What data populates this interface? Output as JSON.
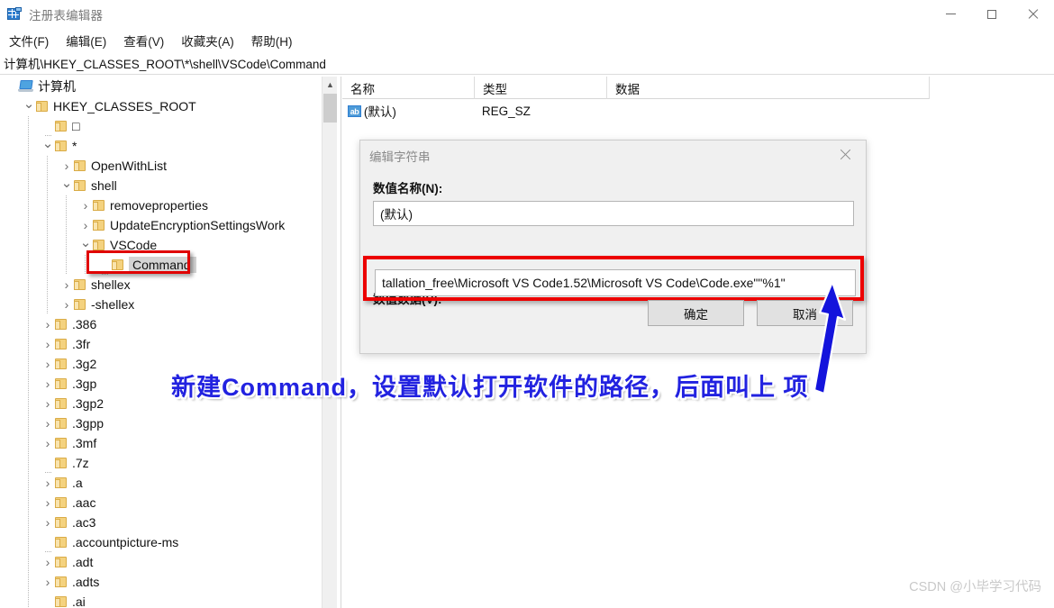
{
  "window": {
    "title": "注册表编辑器",
    "app_icon": "registry-editor-icon",
    "controls": {
      "minimize": "−",
      "maximize": "□",
      "close": "✕"
    }
  },
  "menubar": {
    "items": [
      {
        "label": "文件(F)",
        "name": "menu-file"
      },
      {
        "label": "编辑(E)",
        "name": "menu-edit"
      },
      {
        "label": "查看(V)",
        "name": "menu-view"
      },
      {
        "label": "收藏夹(A)",
        "name": "menu-favorites"
      },
      {
        "label": "帮助(H)",
        "name": "menu-help"
      }
    ]
  },
  "address": {
    "path": "计算机\\HKEY_CLASSES_ROOT\\*\\shell\\VSCode\\Command"
  },
  "tree": {
    "rows": [
      {
        "label": "计算机",
        "indent": 0,
        "chev": "none",
        "icon": "computer"
      },
      {
        "label": "HKEY_CLASSES_ROOT",
        "indent": 1,
        "chev": "expanded",
        "icon": "folder"
      },
      {
        "label": "□",
        "indent": 2,
        "chev": "stub",
        "icon": "folder"
      },
      {
        "label": "*",
        "indent": 2,
        "chev": "expanded",
        "icon": "folder"
      },
      {
        "label": "OpenWithList",
        "indent": 3,
        "chev": "collapsed",
        "icon": "folder"
      },
      {
        "label": "shell",
        "indent": 3,
        "chev": "expanded",
        "icon": "folder"
      },
      {
        "label": "removeproperties",
        "indent": 4,
        "chev": "collapsed",
        "icon": "folder"
      },
      {
        "label": "UpdateEncryptionSettingsWork",
        "indent": 4,
        "chev": "collapsed",
        "icon": "folder"
      },
      {
        "label": "VSCode",
        "indent": 4,
        "chev": "expanded",
        "icon": "folder"
      },
      {
        "label": "Command",
        "indent": 5,
        "chev": "stub",
        "icon": "folder",
        "selected": true
      },
      {
        "label": "shellex",
        "indent": 3,
        "chev": "collapsed",
        "icon": "folder"
      },
      {
        "label": "-shellex",
        "indent": 3,
        "chev": "collapsed",
        "icon": "folder"
      },
      {
        "label": ".386",
        "indent": 2,
        "chev": "collapsed",
        "icon": "folder"
      },
      {
        "label": ".3fr",
        "indent": 2,
        "chev": "collapsed",
        "icon": "folder"
      },
      {
        "label": ".3g2",
        "indent": 2,
        "chev": "collapsed",
        "icon": "folder"
      },
      {
        "label": ".3gp",
        "indent": 2,
        "chev": "collapsed",
        "icon": "folder"
      },
      {
        "label": ".3gp2",
        "indent": 2,
        "chev": "collapsed",
        "icon": "folder"
      },
      {
        "label": ".3gpp",
        "indent": 2,
        "chev": "collapsed",
        "icon": "folder"
      },
      {
        "label": ".3mf",
        "indent": 2,
        "chev": "collapsed",
        "icon": "folder"
      },
      {
        "label": ".7z",
        "indent": 2,
        "chev": "stub",
        "icon": "folder"
      },
      {
        "label": ".a",
        "indent": 2,
        "chev": "collapsed",
        "icon": "folder"
      },
      {
        "label": ".aac",
        "indent": 2,
        "chev": "collapsed",
        "icon": "folder"
      },
      {
        "label": ".ac3",
        "indent": 2,
        "chev": "collapsed",
        "icon": "folder"
      },
      {
        "label": ".accountpicture-ms",
        "indent": 2,
        "chev": "stub",
        "icon": "folder"
      },
      {
        "label": ".adt",
        "indent": 2,
        "chev": "collapsed",
        "icon": "folder"
      },
      {
        "label": ".adts",
        "indent": 2,
        "chev": "collapsed",
        "icon": "folder"
      },
      {
        "label": ".ai",
        "indent": 2,
        "chev": "stub",
        "icon": "folder"
      }
    ]
  },
  "list": {
    "columns": [
      "名称",
      "类型",
      "数据"
    ],
    "rows": [
      {
        "icon": "string-value-icon",
        "name": "(默认)",
        "type": "REG_SZ",
        "data": ""
      }
    ]
  },
  "dialog": {
    "title": "编辑字符串",
    "name_label": "数值名称(N):",
    "name_value": "(默认)",
    "data_label": "数值数据(V):",
    "data_value": "tallation_free\\Microsoft VS Code1.52\\Microsoft VS Code\\Code.exe\"\"%1\"",
    "ok_label": "确定",
    "cancel_label": "取消"
  },
  "annotation": {
    "text": "新建Command，设置默认打开软件的路径，后面叫上 项",
    "color": "#2222e0",
    "arrow_color": "#1414dc",
    "highlight_color": "#e00000"
  },
  "watermark": {
    "text": "CSDN @小毕学习代码"
  }
}
